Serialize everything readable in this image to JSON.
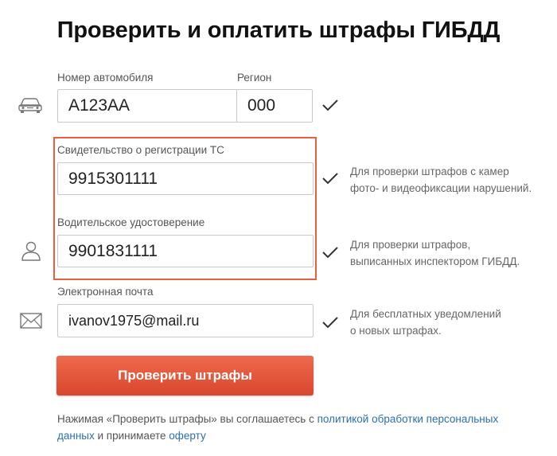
{
  "page": {
    "title": "Проверить и оплатить штрафы ГИБДД"
  },
  "form": {
    "plate": {
      "label": "Номер автомобиля",
      "value": "А123АА"
    },
    "region": {
      "label": "Регион",
      "value": "000"
    },
    "registration": {
      "label": "Свидетельство о регистрации ТС",
      "value": "9915301111"
    },
    "license": {
      "label": "Водительское удостоверение",
      "value": "9901831111"
    },
    "email": {
      "label": "Электронная почта",
      "value": "ivanov1975@mail.ru"
    }
  },
  "hints": {
    "registration": [
      "Для проверки штрафов с камер",
      "фото- и видеофиксации нарушений."
    ],
    "license": [
      "Для проверки штрафов,",
      "выписанных инспектором ГИБДД."
    ],
    "email": [
      "Для бесплатных уведомлений",
      "о новых штрафах."
    ]
  },
  "submit": {
    "label": "Проверить штрафы"
  },
  "consent": {
    "text_before": "Нажимая «Проверить штрафы» вы соглашаетесь с ",
    "privacy_link": "политикой обработки персональных данных",
    "text_middle": " и принимаете ",
    "offer_link": "оферту"
  },
  "icons": {
    "car": "car-icon",
    "person": "person-icon",
    "mail": "envelope-icon",
    "check": "checkmark-icon"
  },
  "colors": {
    "accent": "#e8603f",
    "button": "#de4f34",
    "link": "#2b6fb5"
  }
}
